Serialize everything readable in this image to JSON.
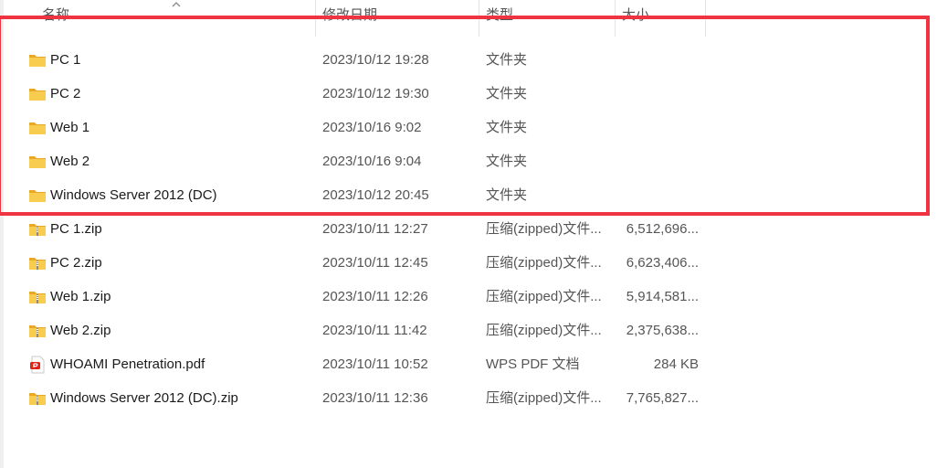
{
  "columns": {
    "name": "名称",
    "date": "修改日期",
    "type": "类型",
    "size": "大小"
  },
  "files": [
    {
      "name": "PC 1",
      "date": "2023/10/12 19:28",
      "type": "文件夹",
      "size": "",
      "icon": "folder-icon"
    },
    {
      "name": "PC 2",
      "date": "2023/10/12 19:30",
      "type": "文件夹",
      "size": "",
      "icon": "folder-icon"
    },
    {
      "name": "Web 1",
      "date": "2023/10/16 9:02",
      "type": "文件夹",
      "size": "",
      "icon": "folder-icon"
    },
    {
      "name": "Web 2",
      "date": "2023/10/16 9:04",
      "type": "文件夹",
      "size": "",
      "icon": "folder-icon"
    },
    {
      "name": "Windows Server 2012 (DC)",
      "date": "2023/10/12 20:45",
      "type": "文件夹",
      "size": "",
      "icon": "folder-icon"
    },
    {
      "name": "PC 1.zip",
      "date": "2023/10/11 12:27",
      "type": "压缩(zipped)文件...",
      "size": "6,512,696...",
      "icon": "zip-folder-icon"
    },
    {
      "name": "PC 2.zip",
      "date": "2023/10/11 12:45",
      "type": "压缩(zipped)文件...",
      "size": "6,623,406...",
      "icon": "zip-folder-icon"
    },
    {
      "name": "Web 1.zip",
      "date": "2023/10/11 12:26",
      "type": "压缩(zipped)文件...",
      "size": "5,914,581...",
      "icon": "zip-folder-icon"
    },
    {
      "name": "Web 2.zip",
      "date": "2023/10/11 11:42",
      "type": "压缩(zipped)文件...",
      "size": "2,375,638...",
      "icon": "zip-folder-icon"
    },
    {
      "name": "WHOAMI Penetration.pdf",
      "date": "2023/10/11 10:52",
      "type": "WPS PDF 文档",
      "size": "284 KB",
      "icon": "pdf-icon"
    },
    {
      "name": "Windows Server 2012 (DC).zip",
      "date": "2023/10/11 12:36",
      "type": "压缩(zipped)文件...",
      "size": "7,765,827...",
      "icon": "zip-folder-icon"
    }
  ],
  "colors": {
    "highlight": "#ef3340",
    "folder": "#f6c344",
    "pdf": "#e2231a"
  }
}
